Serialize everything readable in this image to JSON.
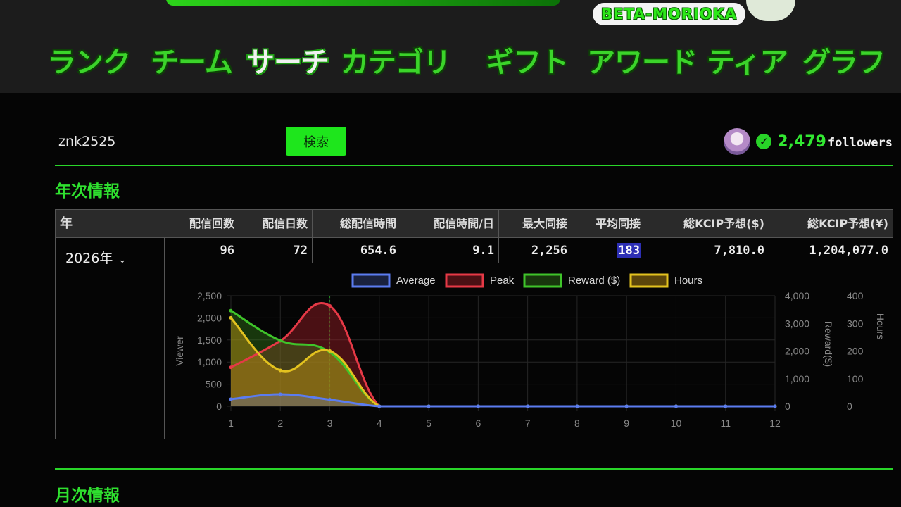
{
  "header": {
    "logo_badge": "BETA-MORIOKA",
    "nav": [
      {
        "label": "ランク",
        "active": false
      },
      {
        "label": "チーム",
        "active": false
      },
      {
        "label": "サーチ",
        "active": true
      },
      {
        "label": "カテゴリ",
        "active": false
      },
      {
        "label": "ギフト",
        "active": false
      },
      {
        "label": "アワード",
        "active": false
      },
      {
        "label": "ティア",
        "active": false
      },
      {
        "label": "グラフ",
        "active": false
      }
    ]
  },
  "search": {
    "value": "znk2525",
    "button_label": "検索"
  },
  "profile": {
    "verified_icon": "check-circle-icon",
    "followers_count": "2,479",
    "followers_label": "followers"
  },
  "annual": {
    "title": "年次情報",
    "headers": [
      "年",
      "配信回数",
      "配信日数",
      "総配信時間",
      "配信時間/日",
      "最大同接",
      "平均同接",
      "総KCIP予想($)",
      "総KCIP予想(¥)"
    ],
    "year_label": "2026年",
    "row": [
      "96",
      "72",
      "654.6",
      "9.1",
      "2,256",
      "183",
      "7,810.0",
      "1,204,077.0"
    ]
  },
  "monthly": {
    "title": "月次情報"
  },
  "chart_data": {
    "type": "line",
    "x": [
      1,
      2,
      3,
      4,
      5,
      6,
      7,
      8,
      9,
      10,
      11,
      12
    ],
    "series": [
      {
        "name": "Average",
        "color": "#5b7cf0",
        "axis": "Viewer",
        "values": [
          160,
          270,
          150,
          0,
          0,
          0,
          0,
          0,
          0,
          0,
          0,
          0
        ]
      },
      {
        "name": "Peak",
        "color": "#e63946",
        "axis": "Viewer",
        "values": [
          880,
          1480,
          2270,
          0,
          0,
          0,
          0,
          0,
          0,
          0,
          0,
          0
        ]
      },
      {
        "name": "Reward ($)",
        "color": "#3fc42a",
        "axis": "Reward($)",
        "values": [
          3460,
          2380,
          1960,
          0,
          0,
          0,
          0,
          0,
          0,
          0,
          0,
          0
        ]
      },
      {
        "name": "Hours",
        "color": "#e3c21f",
        "axis": "Hours",
        "values": [
          320,
          130,
          200,
          0,
          0,
          0,
          0,
          0,
          0,
          0,
          0,
          0
        ]
      }
    ],
    "axes": {
      "left": {
        "label": "Viewer",
        "min": 0,
        "max": 2500,
        "ticks": [
          "0",
          "500",
          "1,000",
          "1,500",
          "2,000",
          "2,500"
        ]
      },
      "right1": {
        "label": "Reward($)",
        "min": 0,
        "max": 4000,
        "ticks": [
          "0",
          "1,000",
          "2,000",
          "3,000",
          "4,000"
        ]
      },
      "right2": {
        "label": "Hours",
        "min": 0,
        "max": 400,
        "ticks": [
          "0",
          "100",
          "200",
          "300",
          "400"
        ]
      }
    },
    "x_ticks": [
      "1",
      "2",
      "3",
      "4",
      "5",
      "6",
      "7",
      "8",
      "9",
      "10",
      "11",
      "12"
    ],
    "legend_position": "top",
    "grid": true
  }
}
